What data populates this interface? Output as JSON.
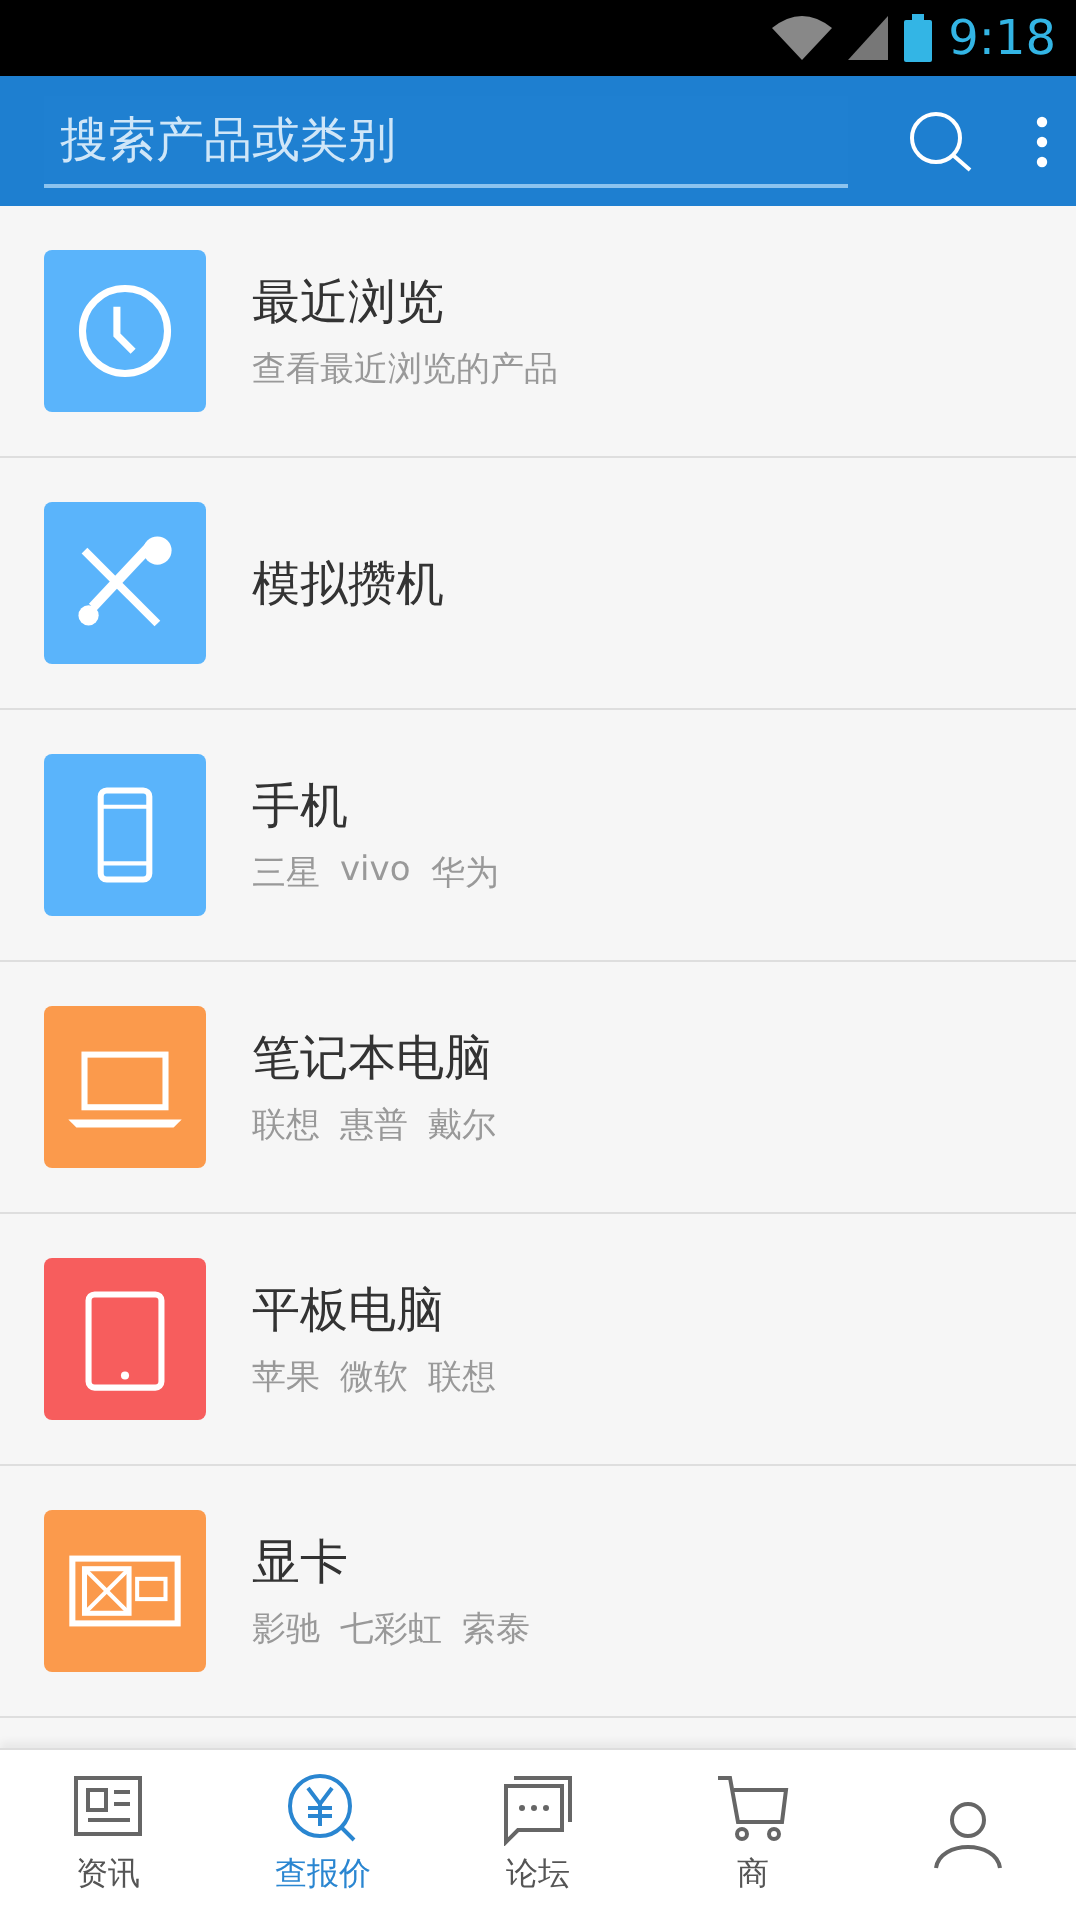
{
  "status_bar": {
    "time": "9:18"
  },
  "search": {
    "placeholder": "搜索产品或类别"
  },
  "categories": [
    {
      "kind": "clock",
      "color": "#5ab4fb",
      "title": "最近浏览",
      "tags": [
        "查看最近浏览的产品"
      ]
    },
    {
      "kind": "tools",
      "color": "#5ab4fb",
      "title": "模拟攒机"
    },
    {
      "kind": "phone",
      "color": "#5ab4fb",
      "title": "手机",
      "tags": [
        "三星",
        "vivo",
        "华为"
      ]
    },
    {
      "kind": "laptop",
      "color": "#fb9a4c",
      "title": "笔记本电脑",
      "tags": [
        "联想",
        "惠普",
        "戴尔"
      ]
    },
    {
      "kind": "tablet",
      "color": "#f75d5d",
      "title": "平板电脑",
      "tags": [
        "苹果",
        "微软",
        "联想"
      ]
    },
    {
      "kind": "gpu",
      "color": "#fb9a4c",
      "title": "显卡",
      "tags": [
        "影驰",
        "七彩虹",
        "索泰"
      ]
    }
  ],
  "nav": [
    {
      "kind": "news",
      "label": "资讯",
      "selected": false
    },
    {
      "kind": "price",
      "label": "查报价",
      "selected": true
    },
    {
      "kind": "forum",
      "label": "论坛",
      "selected": false
    },
    {
      "kind": "cart",
      "label": "商",
      "selected": false
    },
    {
      "kind": "user",
      "selected": false
    }
  ]
}
